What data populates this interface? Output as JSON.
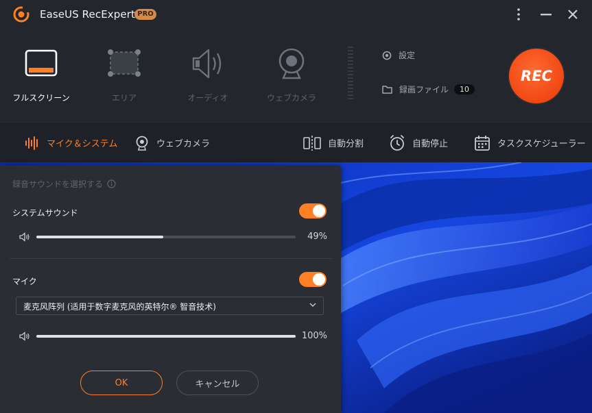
{
  "app": {
    "title": "EaseUS RecExperts",
    "badge": "PRO"
  },
  "modes": [
    {
      "id": "fullscreen",
      "label": "フルスクリーン",
      "active": true
    },
    {
      "id": "area",
      "label": "エリア",
      "active": false
    },
    {
      "id": "audio",
      "label": "オーディオ",
      "active": false
    },
    {
      "id": "webcam",
      "label": "ウェブカメラ",
      "active": false
    }
  ],
  "side": {
    "settings_label": "設定",
    "files_label": "録画ファイル",
    "files_count": "10"
  },
  "rec": {
    "label": "REC"
  },
  "toolbar": {
    "mic_system": "マイク＆システム",
    "webcam": "ウェブカメラ",
    "auto_split": "自動分割",
    "auto_stop": "自動停止",
    "scheduler": "タスクスケジューラー"
  },
  "panel": {
    "title": "録音サウンドを選択する",
    "system_sound": {
      "label": "システムサウンド",
      "enabled": true,
      "volume": 49,
      "volume_text": "49%"
    },
    "mic": {
      "label": "マイク",
      "enabled": true,
      "device": "麦克风阵列 (适用于数字麦克风的英特尔® 智音技术)",
      "volume": 100,
      "volume_text": "100%"
    },
    "ok_label": "OK",
    "cancel_label": "キャンセル"
  },
  "colors": {
    "accent": "#ff7f24",
    "rec": "#f24a14",
    "bg": "#23262d",
    "wallpaper": "#0a1f8c"
  }
}
